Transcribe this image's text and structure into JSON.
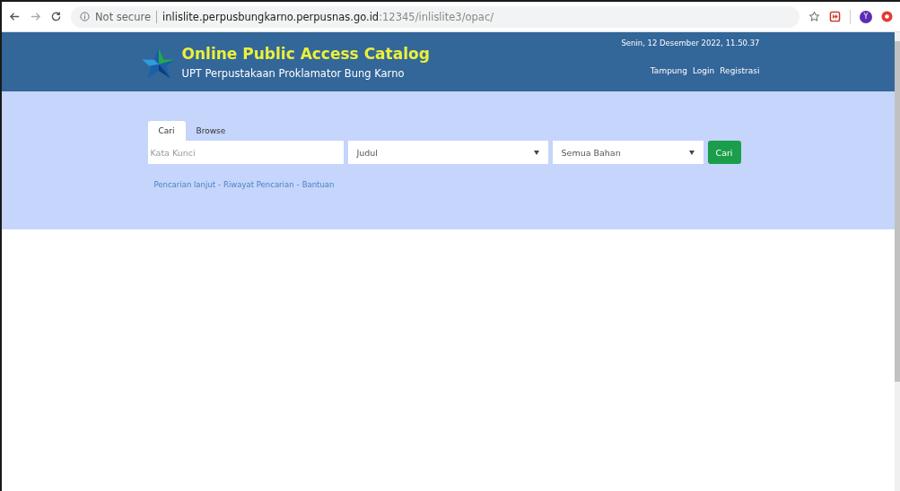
{
  "browser": {
    "security": "Not secure",
    "url_host": "inlislite.perpusbungkarno.perpusnas.go.id",
    "url_path": ":12345/inlislite3/opac/",
    "profile_initial": "Y"
  },
  "header": {
    "title": "Online Public Access Catalog",
    "subtitle": "UPT Perpustakaan Proklamator Bung Karno",
    "datetime": "Senin, 12 Desember 2022, 11.50.37",
    "nav": [
      "Tampung",
      "Login",
      "Registrasi"
    ]
  },
  "search": {
    "tabs": [
      {
        "label": "Cari",
        "selected": true
      },
      {
        "label": "Browse",
        "selected": false
      }
    ],
    "keyword": {
      "placeholder": "Kata Kunci"
    },
    "field_select": "Judul",
    "material_select": "Semua Bahan",
    "button": "Cari",
    "links": [
      "Pencarian lanjut",
      "Riwayat Pencarian",
      "Bantuan"
    ],
    "separator": "-"
  }
}
